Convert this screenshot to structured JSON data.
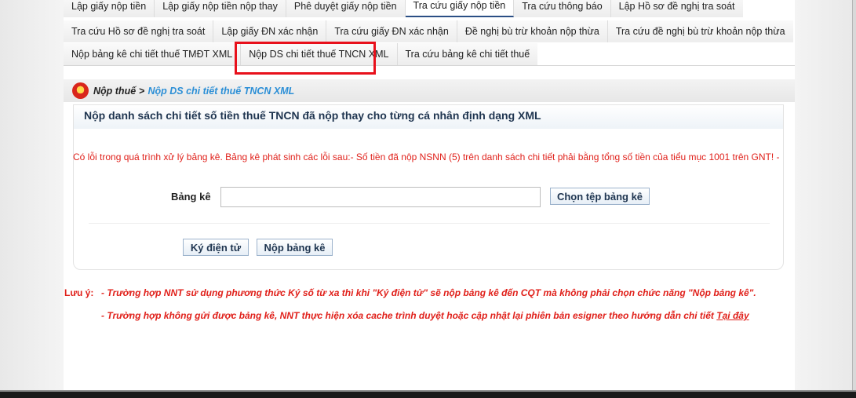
{
  "tabs": {
    "row1": [
      "Lập giấy nộp tiền",
      "Lập giấy nộp tiền nộp thay",
      "Phê duyệt giấy nộp tiền",
      "Tra cứu giấy nộp tiền",
      "Tra cứu thông báo",
      "Lập Hồ sơ đề nghị tra soát"
    ],
    "row2": [
      "Tra cứu Hồ sơ đề nghị tra soát",
      "Lập giấy ĐN xác nhận",
      "Tra cứu giấy ĐN xác nhận",
      "Đề nghị bù trừ khoản nộp thừa",
      "Tra cứu đề nghị bù trừ khoản nộp thừa"
    ],
    "row3": [
      "Nộp bảng kê chi tiết thuế TMĐT XML",
      "Nộp DS chi tiết thuế TNCN XML",
      "Tra cứu bảng kê chi tiết thuế"
    ]
  },
  "breadcrumb": {
    "root": "Nộp thuế",
    "separator": ">",
    "current": "Nộp DS chi tiết thuế TNCN XML"
  },
  "panel": {
    "title": "Nộp danh sách chi tiết số tiền thuế TNCN đã nộp thay cho từng cá nhân định dạng XML"
  },
  "error": {
    "message": "Có lỗi trong quá trình xử lý bảng kê. Bảng kê phát sinh các lỗi sau:- Số tiền đã nộp NSNN (5) trên danh sách chi tiết phải bằng tổng số tiền của tiểu mục 1001 trên GNT! -"
  },
  "form": {
    "label": "Bảng kê",
    "file_value": "",
    "choose_button": "Chọn tệp bảng kê",
    "sign_button": "Ký điện tử",
    "submit_button": "Nộp bảng kê"
  },
  "notes": {
    "label": "Lưu ý:",
    "line1": "- Trường hợp NNT sử dụng phương thức Ký số từ xa thì khi \"Ký điện tử\" sẽ nộp bảng kê đến CQT mà không phải chọn chức năng \"Nộp bảng kê\".",
    "line2": "- Trường hợp không gửi được bảng kê, NNT thực hiện xóa cache trình duyệt hoặc cập nhật lại phiên bản esigner theo hướng dẫn chi tiết",
    "link": "Tại đây"
  },
  "colors": {
    "error": "#e0201a",
    "highlight": "#e8101b",
    "link_blue": "#2c8fd6",
    "title": "#1f3550"
  }
}
